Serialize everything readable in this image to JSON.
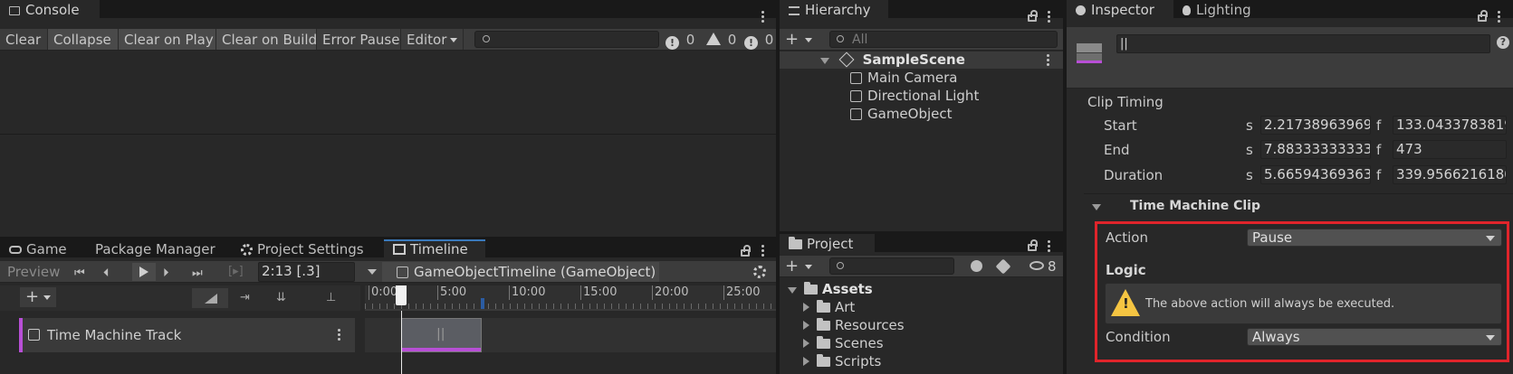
{
  "console": {
    "tab": "Console",
    "buttons": [
      "Clear",
      "Collapse",
      "Clear on Play",
      "Clear on Build",
      "Error Pause",
      "Editor"
    ],
    "counts": {
      "errors": "0",
      "warnings": "0",
      "messages": "0"
    }
  },
  "hierarchy": {
    "tab": "Hierarchy",
    "search_placeholder": "All",
    "scene": "SampleScene",
    "objects": [
      "Main Camera",
      "Directional Light",
      "GameObject"
    ]
  },
  "project": {
    "tab": "Project",
    "hidden_count": "8",
    "root": "Assets",
    "folders": [
      "Art",
      "Resources",
      "Scenes",
      "Scripts"
    ]
  },
  "bottom_tabs": {
    "game": "Game",
    "package_manager": "Package Manager",
    "project_settings": "Project Settings",
    "timeline": "Timeline"
  },
  "timeline": {
    "preview": "Preview",
    "time": "2:13 [.3]",
    "object": "GameObjectTimeline (GameObject)",
    "ruler": [
      "0:00",
      "5:00",
      "10:00",
      "15:00",
      "20:00",
      "25:00"
    ],
    "track": "Time Machine Track",
    "clip_mark": "||",
    "track_color": "#b84fd6"
  },
  "inspector": {
    "tab": "Inspector",
    "tab2": "Lighting",
    "name_value": "||",
    "clip_timing": "Clip Timing",
    "rows": [
      {
        "label": "Start",
        "s": "2.21738963969",
        "f": "133.0433783819"
      },
      {
        "label": "End",
        "s": "7.88333333333",
        "f": "473"
      },
      {
        "label": "Duration",
        "s": "5.66594369363",
        "f": "339.9566216180"
      }
    ],
    "s_label": "s",
    "f_label": "f",
    "section": "Time Machine Clip",
    "action_label": "Action",
    "action_value": "Pause",
    "logic_label": "Logic",
    "warning_text": "The above action will always be executed.",
    "condition_label": "Condition",
    "condition_value": "Always",
    "highlight_color": "#e0242b"
  }
}
